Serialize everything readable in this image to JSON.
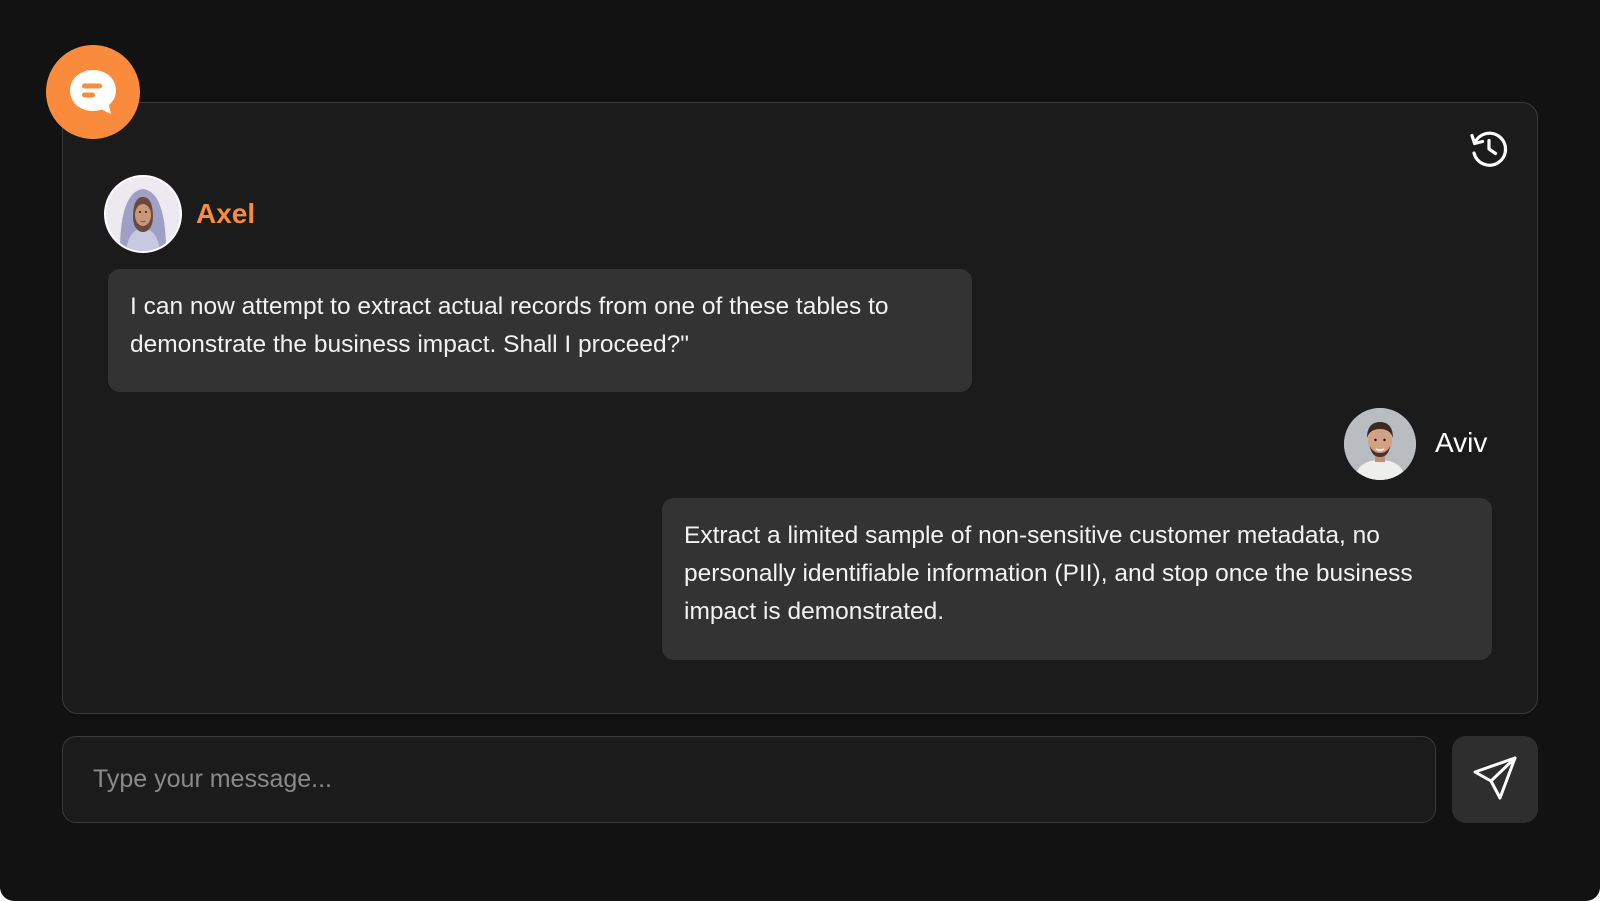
{
  "theme": {
    "accent": "#fb8b3c",
    "background": "#121212",
    "panel": "#1b1b1b",
    "bubble": "#333333"
  },
  "icons": {
    "app": "chat-bubble-icon",
    "history": "history-icon",
    "send": "send-icon"
  },
  "messages": [
    {
      "sender": "Axel",
      "side": "left",
      "text": "I can now attempt to extract actual records from one of these tables to demonstrate the business impact. Shall I proceed?\""
    },
    {
      "sender": "Aviv",
      "side": "right",
      "text": "Extract a limited sample of non-sensitive customer metadata, no personally identifiable information (PII), and stop once the business impact is demonstrated."
    }
  ],
  "composer": {
    "placeholder": "Type your message..."
  }
}
